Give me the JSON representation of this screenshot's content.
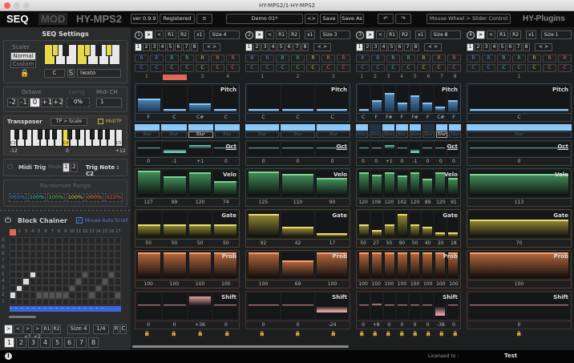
{
  "window": {
    "title": "HY-MPS2/1-HY-MPS2"
  },
  "topbar": {
    "tab_seq": "SEQ",
    "tab_mod": "MOD",
    "product": "HY-MPS2",
    "version": "ver 0.9.9",
    "registered": "Registered",
    "menu": "≡",
    "preset": "Demo 01*",
    "prev_next": "<>",
    "save": "Save",
    "save_as": "Save As",
    "undo": "↶",
    "redo": "↷",
    "mousewheel": "Mouse Wheel > Slider Control",
    "brand": "HY-Plugins"
  },
  "seq_settings": {
    "title": "SEQ Settings",
    "scaler": "Scaler",
    "normal": "Normal",
    "custom": "Custom",
    "root": "C",
    "s": "S",
    "scale": "Iwato",
    "scale_keys": {
      "white": [
        1,
        0,
        0,
        1,
        0,
        0,
        0
      ],
      "black": [
        1,
        0,
        1,
        0,
        1
      ]
    },
    "octave_label": "Octave",
    "octaves": [
      "-2",
      "-1",
      "0",
      "+1",
      "+2"
    ],
    "swing_label": "Swing",
    "swing": "0%",
    "midich_label": "Midi CH",
    "midich": "1",
    "transposer": "Transposer",
    "tp_mode": "TP > Scale",
    "miditp": "MidiTP",
    "c3": "C3",
    "c4": "C4",
    "c5": "C5",
    "tmin": "-12",
    "tmid": "0",
    "tmax": "+12",
    "miditrig": "Midi Trig",
    "mode": "Mode",
    "mode1": "1",
    "mode2": "2",
    "trignote": "Trig Note : C2",
    "randomize": "Randomize Range",
    "rand": [
      {
        "v": "055%",
        "c": "#3a8ee0"
      },
      {
        "v": "100%",
        "c": "#38c0c0"
      },
      {
        "v": "100%",
        "c": "#40c060"
      },
      {
        "v": "100%",
        "c": "#e0d040"
      },
      {
        "v": "000%",
        "c": "#e08030"
      },
      {
        "v": "022%",
        "c": "#e05050"
      }
    ]
  },
  "block_chainer": {
    "title": "Block Chainer",
    "auto_scroll": "Mouse Auto Scroll",
    "cols": [
      "1",
      "2",
      "3",
      "4",
      "5",
      "6",
      "7",
      "8",
      "9",
      "10",
      "11",
      "12",
      "13",
      "14",
      "15",
      "16",
      "17"
    ],
    "rows": [
      "X",
      "R",
      "8",
      "7",
      "6",
      "5",
      "4",
      "3",
      "2",
      "1"
    ],
    "chain": [
      1,
      2,
      3,
      4,
      1,
      1,
      1,
      1,
      1,
      2,
      3,
      4,
      1,
      2,
      3,
      4,
      1
    ],
    "bright": [
      1,
      1,
      1,
      1,
      0,
      0,
      0,
      0,
      0,
      0,
      0,
      0,
      0,
      0,
      0,
      0,
      0
    ],
    "buttons": [
      ">",
      "<",
      "><1",
      "><2",
      "R1",
      "R2"
    ],
    "size": "Size 4",
    "div": "1/4",
    "r": "R",
    "c": "C",
    "pages": [
      "1",
      "2",
      "3",
      "4",
      "5",
      "6",
      "7",
      "8"
    ]
  },
  "columns": [
    {
      "num": "1",
      "size": "Size 4",
      "steps": [
        "1",
        "2",
        "3",
        "4"
      ],
      "current": 1,
      "notes": [
        "F",
        "C",
        "C#",
        "C"
      ],
      "pitch": [
        0.5,
        0.05,
        0.3,
        0.05
      ],
      "slur_on": [
        1,
        1,
        1,
        1
      ],
      "slur_sel": [
        0,
        0,
        1,
        0
      ],
      "oct": [
        "0",
        "-1",
        "+1",
        "0"
      ],
      "velo": [
        "127",
        "99",
        "120",
        "74"
      ],
      "gate": [
        "50",
        "50",
        "50",
        "50"
      ],
      "prob": [
        "100",
        "100",
        "100",
        "100"
      ],
      "shift": [
        "0",
        "0",
        "+36",
        "0"
      ]
    },
    {
      "num": "2",
      "size": "Size 3",
      "steps": [
        "1",
        "2",
        "3"
      ],
      "current": -1,
      "notes": [
        "C",
        "C",
        "C"
      ],
      "pitch": [
        0.05,
        0.05,
        0.05
      ],
      "slur_on": [
        1,
        1,
        1
      ],
      "slur_sel": [
        0,
        0,
        0
      ],
      "oct": [
        "0",
        "0",
        "0"
      ],
      "velo": [
        "125",
        "110",
        "90"
      ],
      "gate": [
        "92",
        "42",
        "17"
      ],
      "prob": [
        "100",
        "69",
        "100"
      ],
      "shift": [
        "0",
        "0",
        "-24"
      ]
    },
    {
      "num": "3",
      "size": "Size 8",
      "steps": [
        "1",
        "2",
        "3",
        "4",
        "5",
        "6",
        "7",
        "8"
      ],
      "current": -1,
      "notes": [
        "C",
        "F",
        "F#",
        "F",
        "F#",
        "F",
        "C#",
        "F"
      ],
      "pitch": [
        0.05,
        0.45,
        0.72,
        0.35,
        0.62,
        0.35,
        0.2,
        0.45
      ],
      "slur_on": [
        1,
        0,
        1,
        1,
        1,
        0,
        1,
        1
      ],
      "slur_sel": [
        0,
        0,
        0,
        0,
        0,
        0,
        1,
        0
      ],
      "oct": [
        "0",
        "0",
        "+1",
        "0",
        "-1",
        "0",
        "0",
        "0"
      ],
      "velo": [
        "120",
        "109",
        "120",
        "102",
        "120",
        "89",
        "120",
        "91"
      ],
      "gate": [
        "50",
        "27",
        "50",
        "90",
        "50",
        "40",
        "20",
        "18"
      ],
      "prob": [
        "100",
        "100",
        "100",
        "100",
        "100",
        "100",
        "100",
        "100"
      ],
      "shift": [
        "0",
        "+8",
        "0",
        "0",
        "0",
        "0",
        "-38",
        "0"
      ]
    },
    {
      "num": "4",
      "size": "Size 1",
      "steps": [
        "1"
      ],
      "current": -1,
      "notes": [
        "C"
      ],
      "pitch": [
        0.05
      ],
      "slur_on": [
        1
      ],
      "slur_sel": [
        0
      ],
      "oct": [
        "0"
      ],
      "velo": [
        "113"
      ],
      "gate": [
        "70"
      ],
      "prob": [
        "100"
      ],
      "shift": [
        "0"
      ]
    }
  ],
  "col_common": {
    "play": ">",
    "rev": "<",
    "r1": "R1",
    "r2": "R2",
    "mult": "x1",
    "pages": [
      "1",
      "2",
      "3",
      "4",
      "5",
      "6",
      "7",
      "8"
    ],
    "nav": "<  >",
    "r": "R",
    "c": "C",
    "slur": "Slur",
    "rc_colors": [
      "#4a90e0",
      "#4a90e0",
      "#40c0b0",
      "#50c060",
      "#e0c040",
      "#e08040",
      "#e06060"
    ],
    "labels": {
      "pitch": "Pitch",
      "oct": "Oct",
      "velo": "Velo",
      "gate": "Gate",
      "prob": "Prob",
      "shift": "Shift"
    }
  },
  "footer": {
    "licensed": "Licensed to :",
    "user": "Test",
    "info": "i"
  }
}
